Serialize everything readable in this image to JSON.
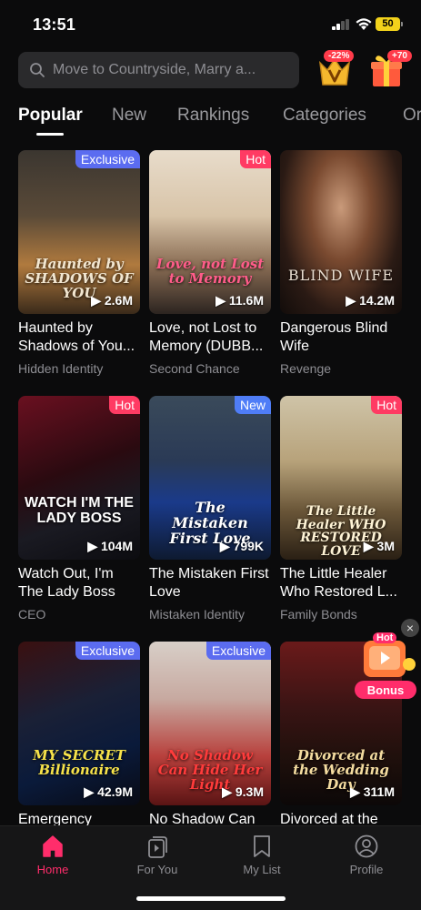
{
  "status": {
    "time": "13:51",
    "battery": "50"
  },
  "search": {
    "placeholder": "Move to Countryside, Marry a..."
  },
  "promos": [
    {
      "badge": "-22%",
      "icon": "vip-crown-icon"
    },
    {
      "badge": "+70",
      "icon": "gift-box-icon"
    }
  ],
  "tabs": [
    "Popular",
    "New",
    "Rankings",
    "Categories",
    "Or"
  ],
  "dramas": [
    {
      "title": "Haunted by Shadows of You...",
      "genre": "Hidden Identity",
      "views": "2.6M",
      "tag": "Exclusive",
      "cover_text": "Haunted by SHADOWS OF YOU"
    },
    {
      "title": "Love, not Lost to Memory (DUBB...",
      "genre": "Second Chance",
      "views": "11.6M",
      "tag": "Hot",
      "cover_text": "Love, not Lost to Memory"
    },
    {
      "title": "Dangerous Blind Wife",
      "genre": "Revenge",
      "views": "14.2M",
      "tag": "",
      "cover_text": "BLIND WIFE"
    },
    {
      "title": "Watch Out, I'm The Lady Boss",
      "genre": "CEO",
      "views": "104M",
      "tag": "Hot",
      "cover_text": "WATCH I'M THE LADY BOSS"
    },
    {
      "title": "The Mistaken First Love",
      "genre": "Mistaken Identity",
      "views": "799K",
      "tag": "New",
      "cover_text": "The Mistaken First Love"
    },
    {
      "title": "The Little Healer Who Restored L...",
      "genre": "Family Bonds",
      "views": "3M",
      "tag": "Hot",
      "cover_text": "The Little Healer WHO RESTORED LOVE"
    },
    {
      "title": "Emergency",
      "genre": "",
      "views": "42.9M",
      "tag": "Exclusive",
      "cover_text": "MY SECRET Billionaire"
    },
    {
      "title": "No Shadow Can",
      "genre": "",
      "views": "9.3M",
      "tag": "Exclusive",
      "cover_text": "No Shadow Can Hide Her Light"
    },
    {
      "title": "Divorced at the",
      "genre": "",
      "views": "311M",
      "tag": "",
      "cover_text": "Divorced at the Wedding Day"
    }
  ],
  "bonus": {
    "label": "Bonus",
    "badge": "Hot"
  },
  "nav": [
    {
      "label": "Home",
      "icon": "home-icon",
      "active": true
    },
    {
      "label": "For You",
      "icon": "play-cards-icon",
      "active": false
    },
    {
      "label": "My List",
      "icon": "bookmark-icon",
      "active": false
    },
    {
      "label": "Profile",
      "icon": "profile-icon",
      "active": false
    }
  ],
  "colors": {
    "accent": "#ff2d6b",
    "tag_exclusive": "#5b6cf0",
    "tag_hot": "#ff3b63",
    "tag_new": "#4f7df7"
  }
}
